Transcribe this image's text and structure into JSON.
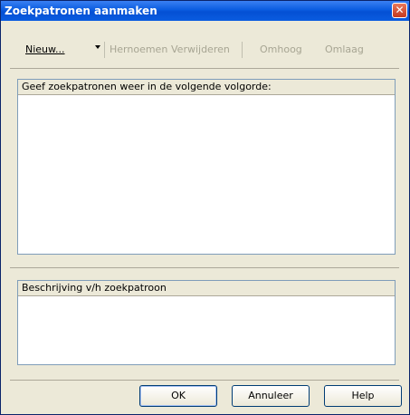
{
  "window": {
    "title": "Zoekpatronen aanmaken",
    "close_symbol": "✕"
  },
  "toolbar": {
    "new_label": "Nieuw...",
    "rename_label": "Hernoemen",
    "delete_label": "Verwijderen",
    "up_label": "Omhoog",
    "down_label": "Omlaag"
  },
  "list_panel": {
    "header": "Geef zoekpatronen weer in de volgende volgorde:"
  },
  "description_panel": {
    "header": "Beschrijving v/h zoekpatroon"
  },
  "buttons": {
    "ok": "OK",
    "cancel": "Annuleer",
    "help": "Help"
  }
}
